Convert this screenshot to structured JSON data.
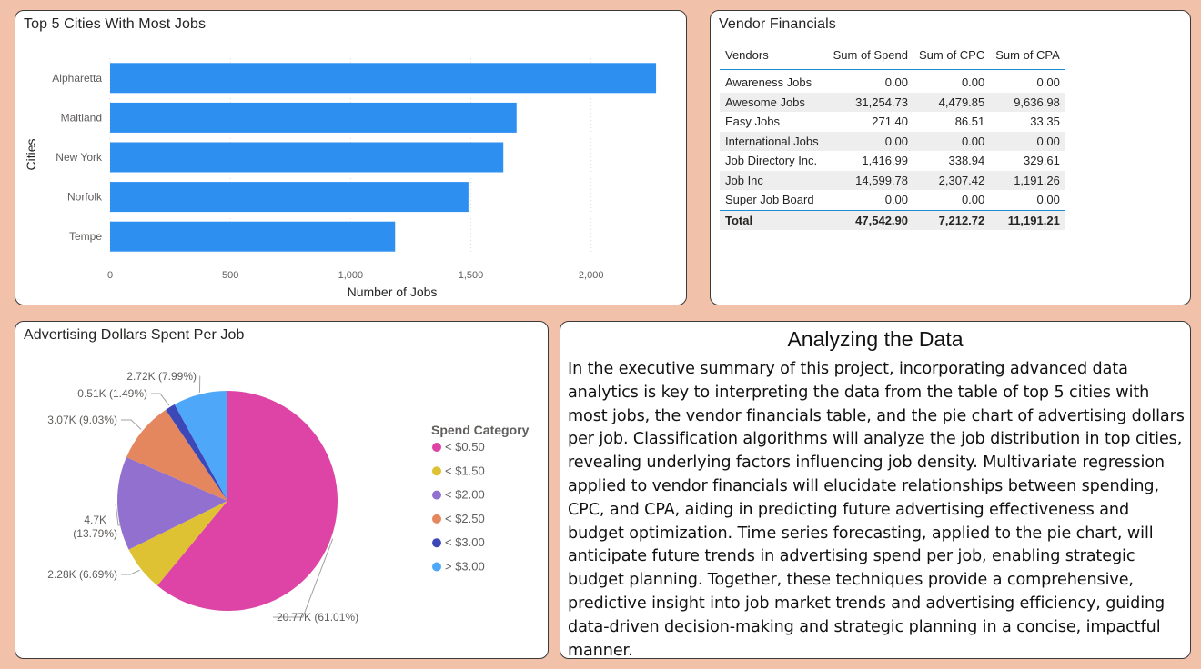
{
  "bar_card": {
    "title": "Top 5 Cities With Most Jobs"
  },
  "vendor_card": {
    "title": "Vendor Financials",
    "columns": [
      "Vendors",
      "Sum of Spend",
      "Sum of CPC",
      "Sum of CPA"
    ],
    "rows": [
      [
        "Awareness Jobs",
        "0.00",
        "0.00",
        "0.00"
      ],
      [
        "Awesome Jobs",
        "31,254.73",
        "4,479.85",
        "9,636.98"
      ],
      [
        "Easy Jobs",
        "271.40",
        "86.51",
        "33.35"
      ],
      [
        "International Jobs",
        "0.00",
        "0.00",
        "0.00"
      ],
      [
        "Job Directory Inc.",
        "1,416.99",
        "338.94",
        "329.61"
      ],
      [
        "Job Inc",
        "14,599.78",
        "2,307.42",
        "1,191.26"
      ],
      [
        "Super Job Board",
        "0.00",
        "0.00",
        "0.00"
      ]
    ],
    "total": [
      "Total",
      "47,542.90",
      "7,212.72",
      "11,191.21"
    ]
  },
  "pie_card": {
    "title": "Advertising Dollars Spent Per Job"
  },
  "text_card": {
    "title": "Analyzing the Data",
    "body": "In the executive summary of this project, incorporating advanced data analytics is key to interpreting the data from the table of top 5 cities with most jobs, the vendor financials table, and the pie chart of advertising dollars per job. Classification algorithms will analyze the job distribution in top cities, revealing underlying factors influencing job density. Multivariate regression applied to vendor financials will elucidate relationships between spending, CPC, and CPA, aiding in predicting future advertising effectiveness and budget optimization. Time series forecasting, applied to the pie chart, will anticipate future trends in advertising spend per job, enabling strategic budget planning. Together, these techniques provide a comprehensive, predictive insight into job market trends and advertising efficiency, guiding data-driven decision-making and strategic planning in a concise, impactful manner."
  },
  "chart_data": [
    {
      "type": "bar",
      "orientation": "horizontal",
      "title": "Top 5 Cities With Most Jobs",
      "xlabel": "Number of Jobs",
      "ylabel": "Cities",
      "categories": [
        "Alpharetta",
        "Maitland",
        "New York",
        "Norfolk",
        "Tempe"
      ],
      "values": [
        2270,
        1690,
        1635,
        1490,
        1185
      ],
      "xlim": [
        0,
        2300
      ],
      "xticks": [
        0,
        500,
        1000,
        1500,
        2000
      ],
      "xtick_labels": [
        "0",
        "500",
        "1,000",
        "1,500",
        "2,000"
      ],
      "grid": "vertical",
      "color": "#2d8ff0"
    },
    {
      "type": "pie",
      "title": "Advertising Dollars Spent Per Job",
      "legend_title": "Spend Category",
      "legend_position": "right",
      "slices": [
        {
          "name": "< $0.50",
          "value": 20.77,
          "label": "20.77K (61.01%)",
          "color": "#dd44a6"
        },
        {
          "name": "< $1.50",
          "value": 2.28,
          "label": "2.28K (6.69%)",
          "color": "#dfc234"
        },
        {
          "name": "< $2.00",
          "value": 4.7,
          "label": "4.7K (13.79%)",
          "color": "#9270cf"
        },
        {
          "name": "< $2.50",
          "value": 3.07,
          "label": "3.07K (9.03%)",
          "color": "#e4875e"
        },
        {
          "name": "< $3.00",
          "value": 0.51,
          "label": "0.51K (1.49%)",
          "color": "#3d48b8"
        },
        {
          "name": "> $3.00",
          "value": 2.72,
          "label": "2.72K (7.99%)",
          "color": "#4ea7f8"
        }
      ]
    }
  ]
}
